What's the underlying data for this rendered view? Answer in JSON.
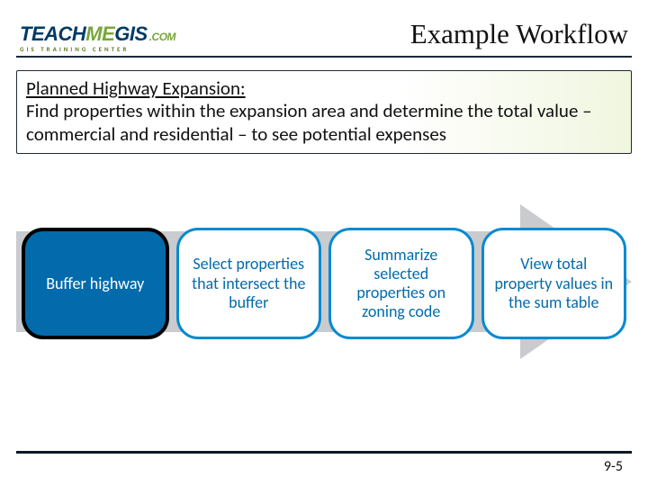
{
  "logo": {
    "teach": "TEACH",
    "me": "ME",
    "gis": "GIS",
    "com": ".COM",
    "sub": "GIS  TRAINING  CENTER"
  },
  "title": "Example Workflow",
  "panel": {
    "heading": "Planned Highway Expansion:",
    "body": "Find properties within the expansion area and determine the total value – commercial and residential – to see potential expenses"
  },
  "steps": [
    {
      "label": "Buffer highway",
      "current": true
    },
    {
      "label": "Select properties that intersect the buffer",
      "current": false
    },
    {
      "label": "Summarize selected properties on zoning code",
      "current": false
    },
    {
      "label": "View total property values in the sum table",
      "current": false
    }
  ],
  "page_number": "9-5"
}
